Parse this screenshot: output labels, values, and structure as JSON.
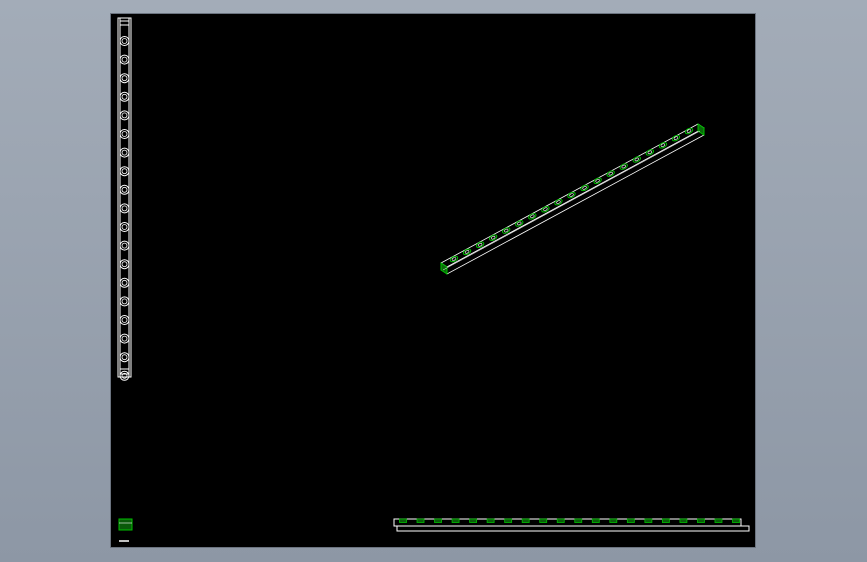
{
  "drawing": {
    "background_color": "#000000",
    "line_color": "#ffffff",
    "accent_color": "#00c000",
    "label_color": "#ff00ff",
    "label_text": "",
    "front_view_hole_count": 19,
    "iso_view_hole_count": 19,
    "side_view_segment_count": 20
  }
}
